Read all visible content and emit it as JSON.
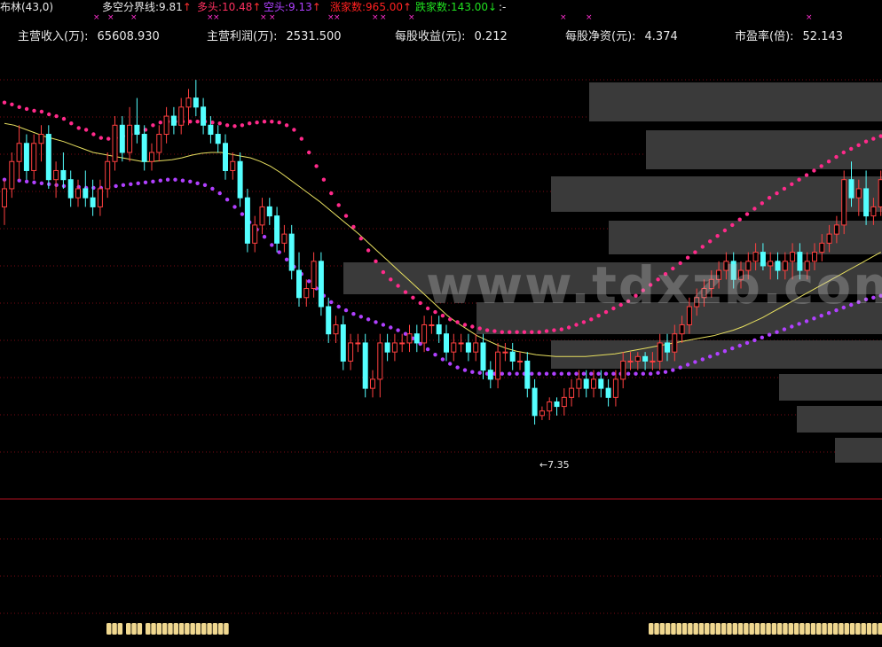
{
  "indicator": {
    "name": "布林(43,0)",
    "items": [
      {
        "label": "多空分界线:",
        "value": "9.81",
        "arrow": "↑",
        "color": "#ffffff"
      },
      {
        "label": "多头:",
        "value": "10.48",
        "arrow": "↑",
        "color": "#ff3060"
      },
      {
        "label": "空头:",
        "value": "9.13",
        "arrow": "↑",
        "color": "#b040ff"
      },
      {
        "label": "涨家数:",
        "value": "965.00",
        "arrow": "↑",
        "color": "#ff2020"
      },
      {
        "label": "跌家数:",
        "value": "143.00",
        "arrow": "↓",
        "color": "#20e020"
      }
    ],
    "suffix": ":-"
  },
  "fundamentals": [
    {
      "label": "主营收入(万):",
      "value": "65608.930"
    },
    {
      "label": "主营利润(万):",
      "value": "2531.500"
    },
    {
      "label": "每股收益(元):",
      "value": "0.212"
    },
    {
      "label": "每股净资(元):",
      "value": "4.374"
    },
    {
      "label": "市盈率(倍):",
      "value": "52.143"
    }
  ],
  "watermark": "www.tdxzb.com",
  "low_label": "←7.35",
  "colors": {
    "up": "#ff4040",
    "down": "#54ffff",
    "upper_band": "#ff2a8a",
    "lower_band": "#b040ff",
    "middle": "#e8e060",
    "grid": "#7a0a14",
    "volume_profile": "#3a3a3a",
    "marker": "#ff30d0",
    "badge": "#f0d890"
  },
  "chart_data": {
    "type": "candlestick",
    "price_range": [
      6.9,
      11.15
    ],
    "candles_ohlc": [
      [
        9.7,
        10.0,
        9.5,
        9.9
      ],
      [
        9.9,
        10.3,
        9.8,
        10.2
      ],
      [
        10.2,
        10.6,
        10.0,
        10.4
      ],
      [
        10.4,
        10.5,
        10.0,
        10.1
      ],
      [
        10.1,
        10.5,
        10.0,
        10.4
      ],
      [
        10.4,
        10.6,
        10.2,
        10.5
      ],
      [
        10.5,
        10.6,
        9.9,
        10.0
      ],
      [
        10.0,
        10.2,
        9.8,
        10.1
      ],
      [
        10.1,
        10.3,
        9.9,
        10.0
      ],
      [
        10.0,
        10.1,
        9.7,
        9.8
      ],
      [
        9.8,
        10.0,
        9.7,
        9.9
      ],
      [
        9.9,
        10.1,
        9.7,
        9.8
      ],
      [
        9.8,
        10.0,
        9.6,
        9.7
      ],
      [
        9.7,
        10.0,
        9.6,
        9.9
      ],
      [
        9.9,
        10.3,
        9.8,
        10.2
      ],
      [
        10.2,
        10.7,
        10.1,
        10.6
      ],
      [
        10.6,
        10.7,
        10.2,
        10.3
      ],
      [
        10.3,
        10.8,
        10.2,
        10.6
      ],
      [
        10.6,
        10.9,
        10.4,
        10.5
      ],
      [
        10.5,
        10.6,
        10.1,
        10.2
      ],
      [
        10.2,
        10.4,
        10.1,
        10.3
      ],
      [
        10.3,
        10.6,
        10.2,
        10.5
      ],
      [
        10.5,
        10.8,
        10.4,
        10.7
      ],
      [
        10.7,
        10.8,
        10.5,
        10.6
      ],
      [
        10.6,
        10.9,
        10.5,
        10.8
      ],
      [
        10.8,
        11.0,
        10.6,
        10.9
      ],
      [
        10.9,
        11.1,
        10.7,
        10.8
      ],
      [
        10.8,
        10.9,
        10.5,
        10.6
      ],
      [
        10.6,
        10.7,
        10.4,
        10.5
      ],
      [
        10.5,
        10.6,
        10.3,
        10.4
      ],
      [
        10.4,
        10.5,
        10.0,
        10.1
      ],
      [
        10.1,
        10.3,
        10.0,
        10.2
      ],
      [
        10.2,
        10.3,
        9.7,
        9.8
      ],
      [
        9.8,
        9.9,
        9.2,
        9.3
      ],
      [
        9.3,
        9.6,
        9.2,
        9.5
      ],
      [
        9.5,
        9.8,
        9.4,
        9.7
      ],
      [
        9.7,
        9.8,
        9.5,
        9.6
      ],
      [
        9.6,
        9.7,
        9.2,
        9.3
      ],
      [
        9.3,
        9.5,
        9.2,
        9.4
      ],
      [
        9.4,
        9.5,
        8.9,
        9.0
      ],
      [
        9.0,
        9.2,
        8.6,
        8.7
      ],
      [
        8.7,
        8.9,
        8.6,
        8.8
      ],
      [
        8.8,
        9.2,
        8.7,
        9.1
      ],
      [
        9.1,
        9.2,
        8.5,
        8.6
      ],
      [
        8.6,
        8.7,
        8.2,
        8.3
      ],
      [
        8.3,
        8.5,
        8.2,
        8.4
      ],
      [
        8.4,
        8.5,
        7.9,
        8.0
      ],
      [
        8.0,
        8.3,
        7.9,
        8.2
      ],
      [
        8.2,
        8.3,
        8.1,
        8.2
      ],
      [
        8.2,
        8.3,
        7.6,
        7.7
      ],
      [
        7.7,
        7.9,
        7.6,
        7.8
      ],
      [
        7.8,
        8.3,
        7.6,
        8.2
      ],
      [
        8.2,
        8.3,
        8.0,
        8.1
      ],
      [
        8.1,
        8.3,
        8.0,
        8.2
      ],
      [
        8.2,
        8.3,
        8.1,
        8.2
      ],
      [
        8.2,
        8.4,
        8.1,
        8.3
      ],
      [
        8.3,
        8.4,
        8.1,
        8.2
      ],
      [
        8.2,
        8.5,
        8.1,
        8.4
      ],
      [
        8.4,
        8.5,
        8.3,
        8.4
      ],
      [
        8.4,
        8.5,
        8.2,
        8.3
      ],
      [
        8.3,
        8.4,
        8.0,
        8.1
      ],
      [
        8.1,
        8.3,
        8.0,
        8.2
      ],
      [
        8.2,
        8.3,
        8.1,
        8.2
      ],
      [
        8.2,
        8.3,
        8.0,
        8.1
      ],
      [
        8.1,
        8.3,
        8.0,
        8.2
      ],
      [
        8.2,
        8.3,
        7.8,
        7.9
      ],
      [
        7.9,
        8.0,
        7.7,
        7.8
      ],
      [
        7.8,
        8.2,
        7.7,
        8.1
      ],
      [
        8.1,
        8.2,
        8.0,
        8.1
      ],
      [
        8.1,
        8.2,
        7.9,
        8.0
      ],
      [
        8.0,
        8.1,
        7.9,
        8.0
      ],
      [
        8.0,
        8.1,
        7.6,
        7.7
      ],
      [
        7.7,
        7.8,
        7.3,
        7.4
      ],
      [
        7.4,
        7.5,
        7.35,
        7.45
      ],
      [
        7.45,
        7.6,
        7.35,
        7.55
      ],
      [
        7.55,
        7.6,
        7.4,
        7.5
      ],
      [
        7.5,
        7.7,
        7.4,
        7.6
      ],
      [
        7.6,
        7.8,
        7.5,
        7.7
      ],
      [
        7.7,
        7.9,
        7.6,
        7.8
      ],
      [
        7.8,
        7.9,
        7.6,
        7.7
      ],
      [
        7.7,
        7.9,
        7.6,
        7.8
      ],
      [
        7.8,
        7.9,
        7.6,
        7.7
      ],
      [
        7.7,
        7.8,
        7.5,
        7.6
      ],
      [
        7.6,
        7.9,
        7.5,
        7.8
      ],
      [
        7.8,
        8.1,
        7.7,
        8.0
      ],
      [
        8.0,
        8.1,
        7.9,
        8.0
      ],
      [
        8.0,
        8.1,
        7.9,
        8.05
      ],
      [
        8.05,
        8.1,
        7.9,
        8.0
      ],
      [
        8.0,
        8.1,
        7.9,
        8.0
      ],
      [
        8.0,
        8.3,
        7.9,
        8.2
      ],
      [
        8.2,
        8.3,
        8.0,
        8.1
      ],
      [
        8.1,
        8.4,
        8.0,
        8.3
      ],
      [
        8.3,
        8.5,
        8.2,
        8.4
      ],
      [
        8.4,
        8.7,
        8.3,
        8.6
      ],
      [
        8.6,
        8.8,
        8.5,
        8.7
      ],
      [
        8.7,
        8.9,
        8.6,
        8.8
      ],
      [
        8.8,
        9.0,
        8.7,
        8.9
      ],
      [
        8.9,
        9.1,
        8.8,
        9.0
      ],
      [
        9.0,
        9.2,
        8.9,
        9.1
      ],
      [
        9.1,
        9.2,
        8.8,
        8.9
      ],
      [
        8.9,
        9.1,
        8.8,
        9.0
      ],
      [
        9.0,
        9.2,
        8.9,
        9.1
      ],
      [
        9.1,
        9.3,
        9.0,
        9.2
      ],
      [
        9.2,
        9.3,
        9.0,
        9.05
      ],
      [
        9.05,
        9.2,
        8.9,
        9.1
      ],
      [
        9.1,
        9.2,
        8.9,
        9.0
      ],
      [
        9.0,
        9.2,
        8.9,
        9.1
      ],
      [
        9.1,
        9.3,
        8.9,
        9.2
      ],
      [
        9.2,
        9.3,
        8.9,
        9.0
      ],
      [
        9.0,
        9.2,
        8.9,
        9.1
      ],
      [
        9.1,
        9.3,
        9.0,
        9.2
      ],
      [
        9.2,
        9.4,
        9.1,
        9.3
      ],
      [
        9.3,
        9.5,
        9.2,
        9.4
      ],
      [
        9.4,
        9.6,
        9.3,
        9.5
      ],
      [
        9.5,
        10.1,
        9.4,
        10.0
      ],
      [
        10.0,
        10.2,
        9.7,
        9.8
      ],
      [
        9.8,
        10.0,
        9.6,
        9.9
      ],
      [
        9.9,
        10.1,
        9.5,
        9.6
      ],
      [
        9.6,
        9.8,
        9.5,
        9.7
      ],
      [
        9.7,
        10.1,
        9.6,
        10.0
      ]
    ],
    "upper_band": [
      10.85,
      10.83,
      10.8,
      10.78,
      10.76,
      10.75,
      10.72,
      10.7,
      10.67,
      10.62,
      10.57,
      10.55,
      10.5,
      10.46,
      10.45,
      10.46,
      10.48,
      10.5,
      10.52,
      10.55,
      10.6,
      10.63,
      10.64,
      10.64,
      10.64,
      10.64,
      10.64,
      10.64,
      10.63,
      10.62,
      10.6,
      10.59,
      10.6,
      10.62,
      10.63,
      10.64,
      10.64,
      10.63,
      10.6,
      10.55,
      10.45,
      10.3,
      10.15,
      10.0,
      9.85,
      9.72,
      9.6,
      9.48,
      9.35,
      9.22,
      9.1,
      8.98,
      8.9,
      8.83,
      8.76,
      8.7,
      8.64,
      8.58,
      8.54,
      8.5,
      8.46,
      8.43,
      8.4,
      8.38,
      8.36,
      8.34,
      8.33,
      8.32,
      8.32,
      8.32,
      8.32,
      8.32,
      8.32,
      8.33,
      8.34,
      8.35,
      8.37,
      8.4,
      8.43,
      8.46,
      8.5,
      8.54,
      8.58,
      8.62,
      8.66,
      8.72,
      8.78,
      8.84,
      8.9,
      8.96,
      9.02,
      9.08,
      9.14,
      9.2,
      9.26,
      9.32,
      9.38,
      9.44,
      9.5,
      9.56,
      9.62,
      9.68,
      9.74,
      9.8,
      9.85,
      9.9,
      9.95,
      10.0,
      10.05,
      10.1,
      10.15,
      10.2,
      10.25,
      10.3,
      10.34,
      10.38,
      10.42,
      10.45,
      10.48
    ],
    "lower_band": [
      10.0,
      10.0,
      9.99,
      9.98,
      9.97,
      9.96,
      9.95,
      9.94,
      9.93,
      9.92,
      9.92,
      9.91,
      9.91,
      9.91,
      9.92,
      9.93,
      9.94,
      9.95,
      9.96,
      9.97,
      9.98,
      9.99,
      10.0,
      10.0,
      9.99,
      9.98,
      9.96,
      9.94,
      9.9,
      9.85,
      9.78,
      9.7,
      9.62,
      9.53,
      9.45,
      9.37,
      9.28,
      9.2,
      9.12,
      9.04,
      8.96,
      8.88,
      8.8,
      8.72,
      8.65,
      8.6,
      8.56,
      8.52,
      8.49,
      8.46,
      8.43,
      8.4,
      8.37,
      8.34,
      8.3,
      8.25,
      8.19,
      8.13,
      8.07,
      8.02,
      7.97,
      7.93,
      7.9,
      7.88,
      7.87,
      7.86,
      7.86,
      7.86,
      7.86,
      7.86,
      7.86,
      7.86,
      7.86,
      7.86,
      7.86,
      7.86,
      7.86,
      7.86,
      7.86,
      7.86,
      7.86,
      7.86,
      7.86,
      7.86,
      7.86,
      7.86,
      7.86,
      7.86,
      7.87,
      7.88,
      7.9,
      7.93,
      7.96,
      7.99,
      8.02,
      8.05,
      8.08,
      8.11,
      8.14,
      8.17,
      8.2,
      8.23,
      8.26,
      8.29,
      8.32,
      8.35,
      8.38,
      8.41,
      8.44,
      8.47,
      8.5,
      8.53,
      8.56,
      8.59,
      8.62,
      8.65,
      8.68,
      8.7,
      8.72
    ],
    "middle_line": [
      10.62,
      10.6,
      10.56,
      10.52,
      10.48,
      10.45,
      10.42,
      10.38,
      10.34,
      10.3,
      10.28,
      10.26,
      10.24,
      10.22,
      10.2,
      10.2,
      10.21,
      10.22,
      10.24,
      10.27,
      10.29,
      10.3,
      10.3,
      10.28,
      10.26,
      10.24,
      10.2,
      10.15,
      10.08,
      10.0,
      9.92,
      9.84,
      9.76,
      9.67,
      9.58,
      9.49,
      9.4,
      9.3,
      9.2,
      9.1,
      9.0,
      8.9,
      8.8,
      8.7,
      8.6,
      8.5,
      8.42,
      8.35,
      8.28,
      8.23,
      8.18,
      8.14,
      8.11,
      8.09,
      8.07,
      8.06,
      8.05,
      8.05,
      8.05,
      8.05,
      8.06,
      8.07,
      8.08,
      8.1,
      8.12,
      8.14,
      8.16,
      8.18,
      8.2,
      8.22,
      8.24,
      8.26,
      8.28,
      8.31,
      8.34,
      8.38,
      8.43,
      8.48,
      8.54,
      8.6,
      8.66,
      8.72,
      8.78,
      8.84,
      8.9,
      8.96,
      9.02,
      9.08,
      9.14,
      9.2
    ],
    "low_marker_price": 7.35
  }
}
